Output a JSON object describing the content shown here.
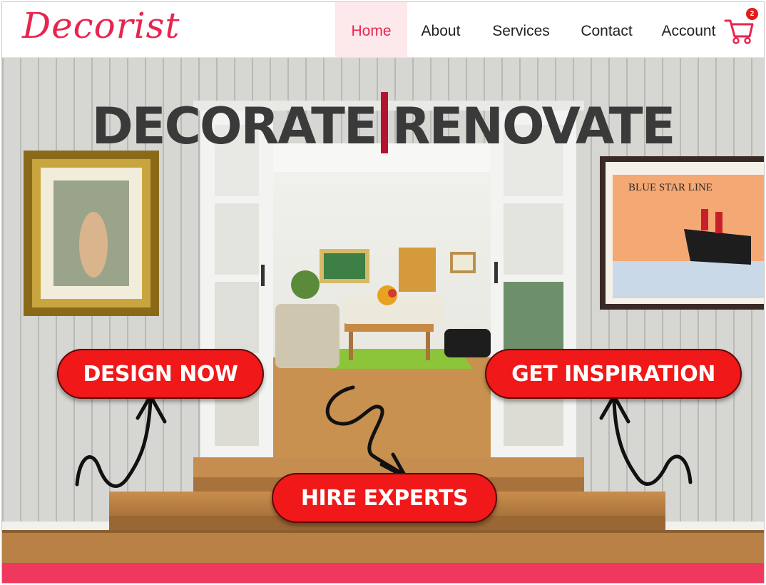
{
  "brand": {
    "logo_text": "Decorist",
    "accent": "#e8254e"
  },
  "nav": {
    "items": [
      {
        "label": "Home",
        "active": true
      },
      {
        "label": "About",
        "active": false
      },
      {
        "label": "Services",
        "active": false
      },
      {
        "label": "Contact",
        "active": false
      },
      {
        "label": "Account",
        "active": false
      }
    ],
    "cart_icon": "shopping-cart-icon",
    "cart_count": "2"
  },
  "hero": {
    "headline_left": "DECORATE",
    "headline_right": "RENOVATE",
    "cta_design": "DESIGN NOW",
    "cta_inspiration": "GET INSPIRATION",
    "cta_hire": "HIRE EXPERTS",
    "cta_color": "#f01818",
    "painting_left_icon": "framed-painting-icon",
    "painting_right_text": "BLUE STAR LINE"
  }
}
